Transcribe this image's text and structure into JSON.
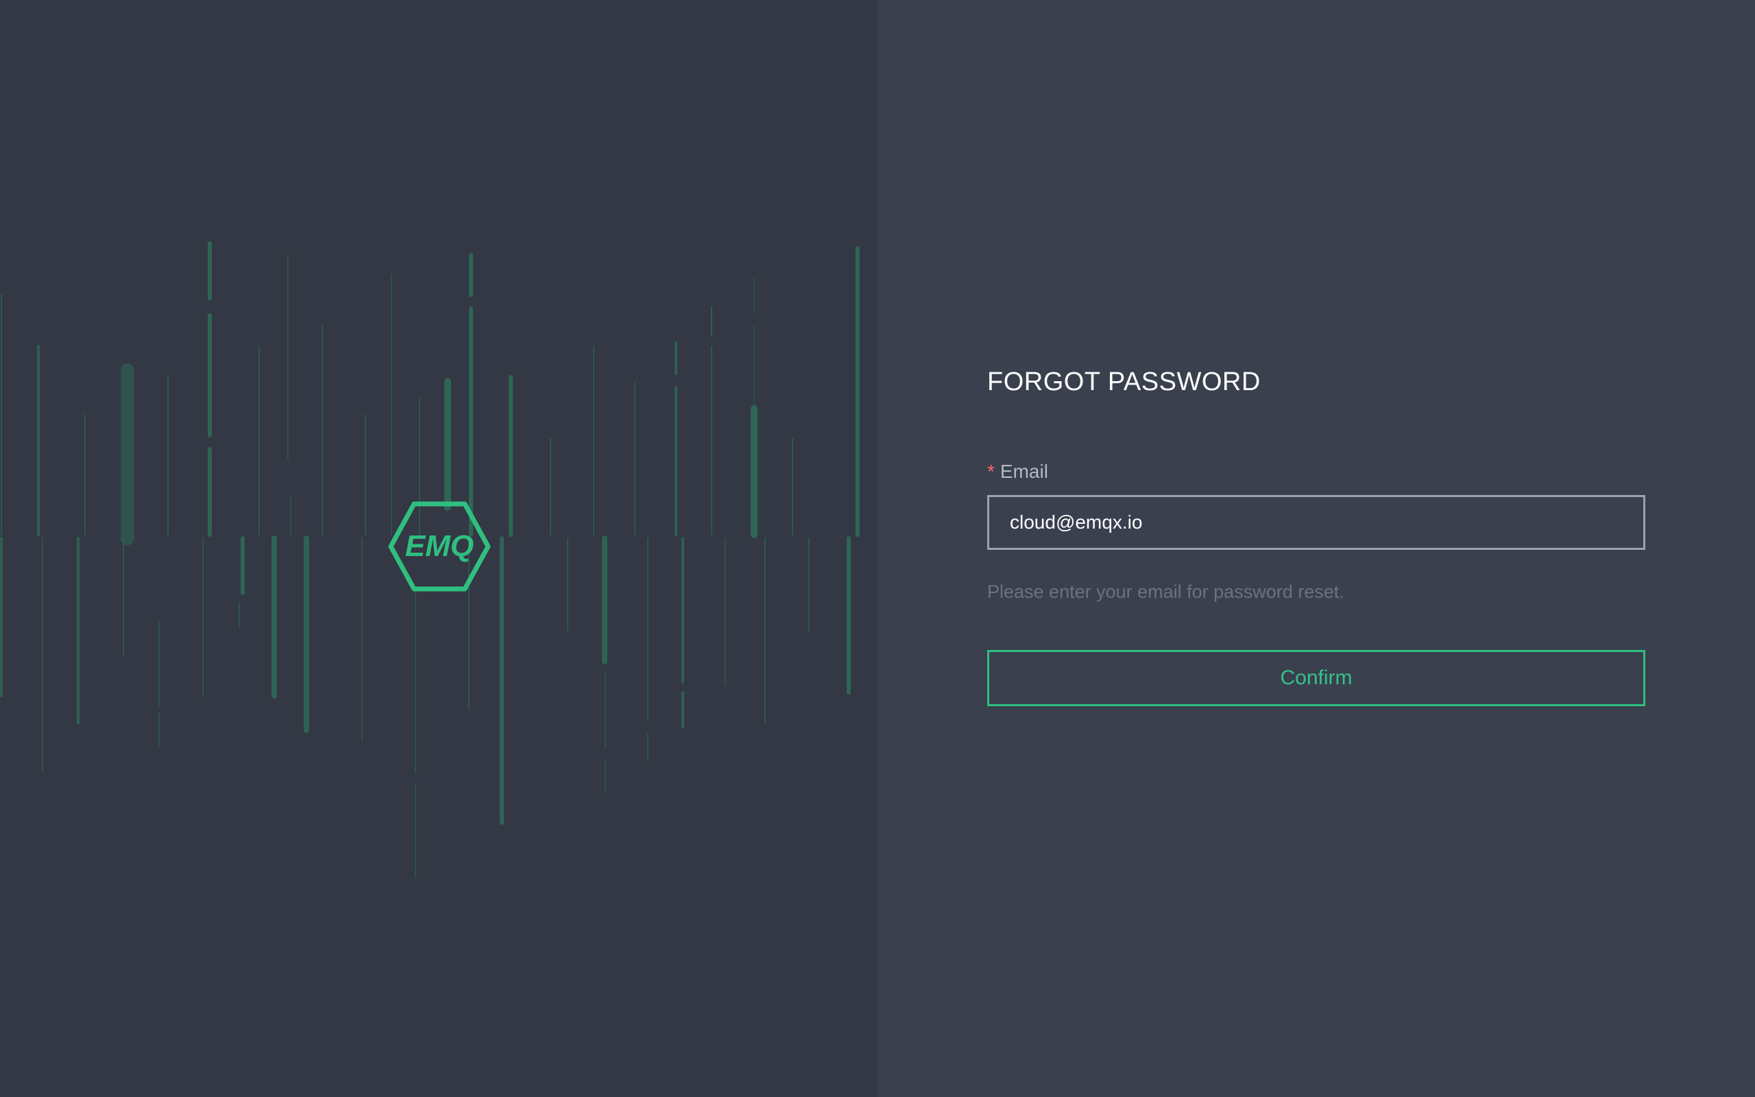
{
  "brand": {
    "logo_text": "EMQ",
    "accent_color": "#2fbf80",
    "logo_icon": "hexagon-logo-icon"
  },
  "form": {
    "title": "FORGOT PASSWORD",
    "required_mark": "*",
    "email_label": "Email",
    "email_value": "cloud@emqx.io",
    "hint": "Please enter your email for password reset.",
    "confirm_label": "Confirm"
  },
  "colors": {
    "left_background": "#333844",
    "right_background": "#3a404e",
    "required_mark": "#f56c6c"
  }
}
